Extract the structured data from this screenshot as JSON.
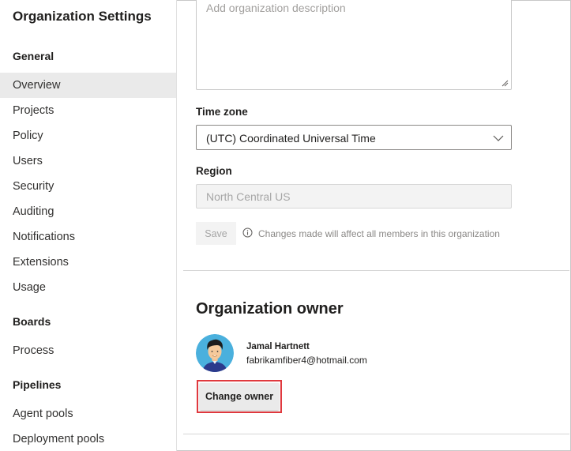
{
  "sidebar": {
    "title": "Organization Settings",
    "groups": [
      {
        "label": "General",
        "items": [
          {
            "label": "Overview",
            "selected": true
          },
          {
            "label": "Projects"
          },
          {
            "label": "Policy"
          },
          {
            "label": "Users"
          },
          {
            "label": "Security"
          },
          {
            "label": "Auditing"
          },
          {
            "label": "Notifications"
          },
          {
            "label": "Extensions"
          },
          {
            "label": "Usage"
          }
        ]
      },
      {
        "label": "Boards",
        "items": [
          {
            "label": "Process"
          }
        ]
      },
      {
        "label": "Pipelines",
        "items": [
          {
            "label": "Agent pools"
          },
          {
            "label": "Deployment pools"
          }
        ]
      }
    ]
  },
  "main": {
    "description": {
      "placeholder": "Add organization description",
      "value": ""
    },
    "timezone": {
      "label": "Time zone",
      "value": "(UTC) Coordinated Universal Time"
    },
    "region": {
      "label": "Region",
      "value": "North Central US"
    },
    "save": {
      "label": "Save",
      "info": "Changes made will affect all members in this organization"
    },
    "owner_section": {
      "title": "Organization owner",
      "name": "Jamal Hartnett",
      "email": "fabrikamfiber4@hotmail.com",
      "change_button": "Change owner"
    }
  },
  "colors": {
    "highlight": "#e0393e",
    "selected_nav_bg": "#eaeaea",
    "avatar_bg": "#4ab0dd"
  }
}
